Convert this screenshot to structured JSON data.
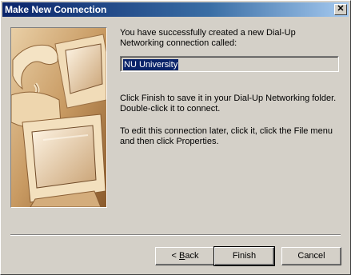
{
  "window": {
    "title": "Make New Connection",
    "close_glyph": "✕"
  },
  "message": {
    "intro": "You have successfully created a new Dial-Up Networking connection called:",
    "connection_name": "NU University",
    "finish_hint": "Click Finish to save it in your Dial-Up Networking folder. Double-click it to connect.",
    "edit_hint": "To edit this connection later, click it, click the File menu and then click Properties."
  },
  "buttons": {
    "back_prefix": "< ",
    "back_accel": "B",
    "back_rest": "ack",
    "finish": "Finish",
    "cancel": "Cancel"
  },
  "illustration": {
    "icon": "computers-and-phone-illustration",
    "tint": "#c89a62"
  }
}
